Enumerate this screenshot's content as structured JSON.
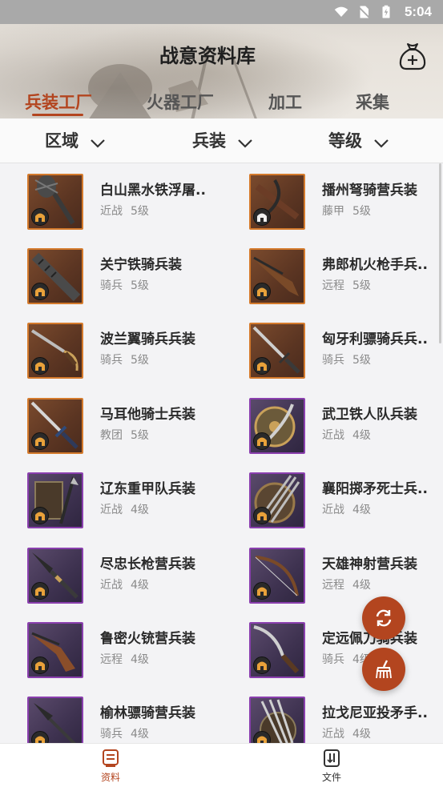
{
  "status_bar": {
    "time": "5:04"
  },
  "header": {
    "title": "战意资料库"
  },
  "category_tabs": [
    {
      "label": "兵装工厂",
      "active": true
    },
    {
      "label": "火器工厂",
      "active": false
    },
    {
      "label": "加工",
      "active": false
    },
    {
      "label": "采集",
      "active": false
    }
  ],
  "filters": [
    {
      "label": "区域"
    },
    {
      "label": "兵装"
    },
    {
      "label": "等级"
    }
  ],
  "items": [
    {
      "name": "白山黑水铁浮屠..",
      "type": "近战",
      "level": "5级",
      "rarity": "orange",
      "icon": "flail-icon"
    },
    {
      "name": "播州弩骑营兵装",
      "type": "藤甲",
      "level": "5级",
      "rarity": "orange",
      "icon": "crossbow-icon"
    },
    {
      "name": "关宁铁骑兵装",
      "type": "骑兵",
      "level": "5级",
      "rarity": "orange",
      "icon": "mace-icon"
    },
    {
      "name": "弗郎机火枪手兵..",
      "type": "远程",
      "level": "5级",
      "rarity": "orange",
      "icon": "musket-icon"
    },
    {
      "name": "波兰翼骑兵兵装",
      "type": "骑兵",
      "level": "5级",
      "rarity": "orange",
      "icon": "saber-icon"
    },
    {
      "name": "匈牙利骠骑兵兵..",
      "type": "骑兵",
      "level": "5级",
      "rarity": "orange",
      "icon": "sword-icon"
    },
    {
      "name": "马耳他骑士兵装",
      "type": "教团",
      "level": "5级",
      "rarity": "orange",
      "icon": "longsword-icon"
    },
    {
      "name": "武卫铁人队兵装",
      "type": "近战",
      "level": "4级",
      "rarity": "purple",
      "icon": "shield-saber-icon"
    },
    {
      "name": "辽东重甲队兵装",
      "type": "近战",
      "level": "4级",
      "rarity": "purple",
      "icon": "polearm-icon"
    },
    {
      "name": "襄阳掷矛死士兵..",
      "type": "近战",
      "level": "4级",
      "rarity": "purple",
      "icon": "javelin-shield-icon"
    },
    {
      "name": "尽忠长枪营兵装",
      "type": "近战",
      "level": "4级",
      "rarity": "purple",
      "icon": "spearhead-icon"
    },
    {
      "name": "天雄神射营兵装",
      "type": "远程",
      "level": "4级",
      "rarity": "purple",
      "icon": "bow-icon"
    },
    {
      "name": "鲁密火铳营兵装",
      "type": "远程",
      "level": "4级",
      "rarity": "purple",
      "icon": "pistol-icon"
    },
    {
      "name": "定远佩刀骑兵装",
      "type": "骑兵",
      "level": "4级",
      "rarity": "purple",
      "icon": "sabre-icon"
    },
    {
      "name": "榆林骠骑营兵装",
      "type": "骑兵",
      "level": "4级",
      "rarity": "purple",
      "icon": "spear-icon"
    },
    {
      "name": "拉戈尼亚投矛手..",
      "type": "近战",
      "level": "4级",
      "rarity": "purple",
      "icon": "javelins-icon"
    }
  ],
  "bottom_nav": [
    {
      "label": "资料",
      "active": true,
      "icon": "book-icon"
    },
    {
      "label": "文件",
      "active": false,
      "icon": "file-sort-icon"
    }
  ],
  "colors": {
    "accent": "#b3451f",
    "orange_border": "#d47a2c",
    "purple_border": "#8a3fae"
  }
}
